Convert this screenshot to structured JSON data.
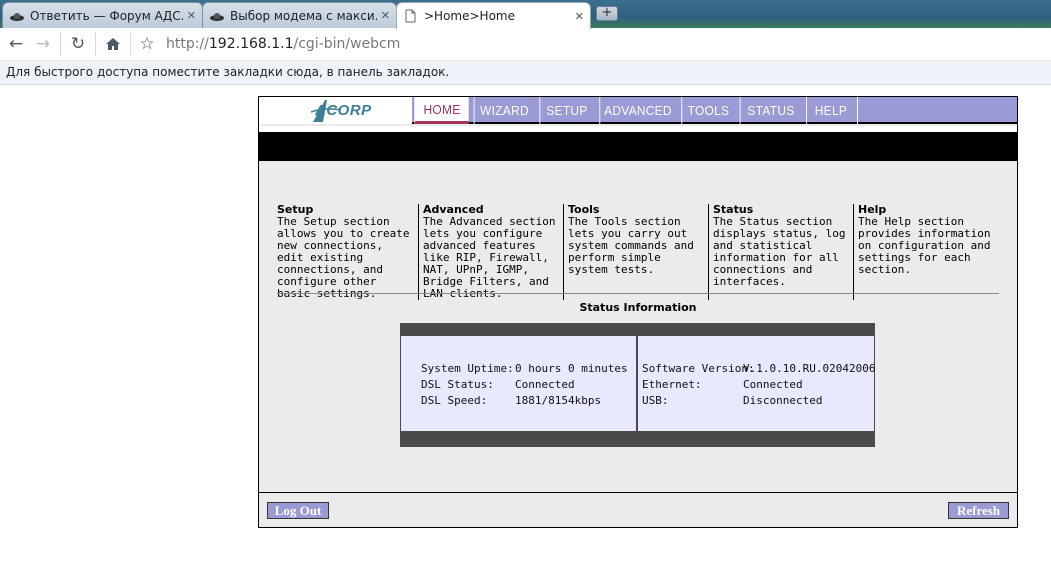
{
  "browser": {
    "tabs": [
      {
        "title": "Ответить — Форум АДС...",
        "active": false
      },
      {
        "title": "Выбор модема с макси...",
        "active": false
      },
      {
        "title": ">Home>Home",
        "active": true
      }
    ],
    "new_tab_label": "+",
    "url_prefix": "http://",
    "url_host": "192.168.1.1",
    "url_path": "/cgi-bin/webcm",
    "bookmarks_hint": "Для быстрого доступа поместите закладки сюда, в панель закладок."
  },
  "router": {
    "logo": "ACORP",
    "colors": {
      "menu_bg": "#9a9ad4",
      "active_tab_text": "#a3315a",
      "status_panel": "#e8e8ff"
    },
    "menu": [
      {
        "label": "HOME",
        "active": true
      },
      {
        "label": "WIZARD",
        "active": false
      },
      {
        "label": "SETUP",
        "active": false
      },
      {
        "label": "ADVANCED",
        "active": false
      },
      {
        "label": "TOOLS",
        "active": false
      },
      {
        "label": "STATUS",
        "active": false
      },
      {
        "label": "HELP",
        "active": false
      }
    ],
    "sections": [
      {
        "title": "Setup",
        "body": "The Setup section allows you to create new connections, edit existing connections, and configure other basic settings."
      },
      {
        "title": "Advanced",
        "body": "The Advanced section lets you configure advanced features like RIP, Firewall, NAT, UPnP, IGMP, Bridge Filters, and LAN clients."
      },
      {
        "title": "Tools",
        "body": "The Tools section lets you carry out system commands and perform simple system tests."
      },
      {
        "title": "Status",
        "body": "The Status section displays status, log and statistical information for all connections and interfaces."
      },
      {
        "title": "Help",
        "body": "The Help section provides information on configuration and settings for each section."
      }
    ],
    "status_heading": "Status Information",
    "status_left": [
      {
        "label": "System Uptime:",
        "value": "0 hours 0 minutes"
      },
      {
        "label": "DSL Status:",
        "value": "Connected"
      },
      {
        "label": "DSL Speed:",
        "value": "1881/8154kbps"
      }
    ],
    "status_right": [
      {
        "label": "Software Version:",
        "value": "V.1.0.10.RU.02042006"
      },
      {
        "label": "Ethernet:",
        "value": "Connected"
      },
      {
        "label": "USB:",
        "value": "Disconnected"
      }
    ],
    "logout_label": "Log Out",
    "refresh_label": "Refresh"
  }
}
